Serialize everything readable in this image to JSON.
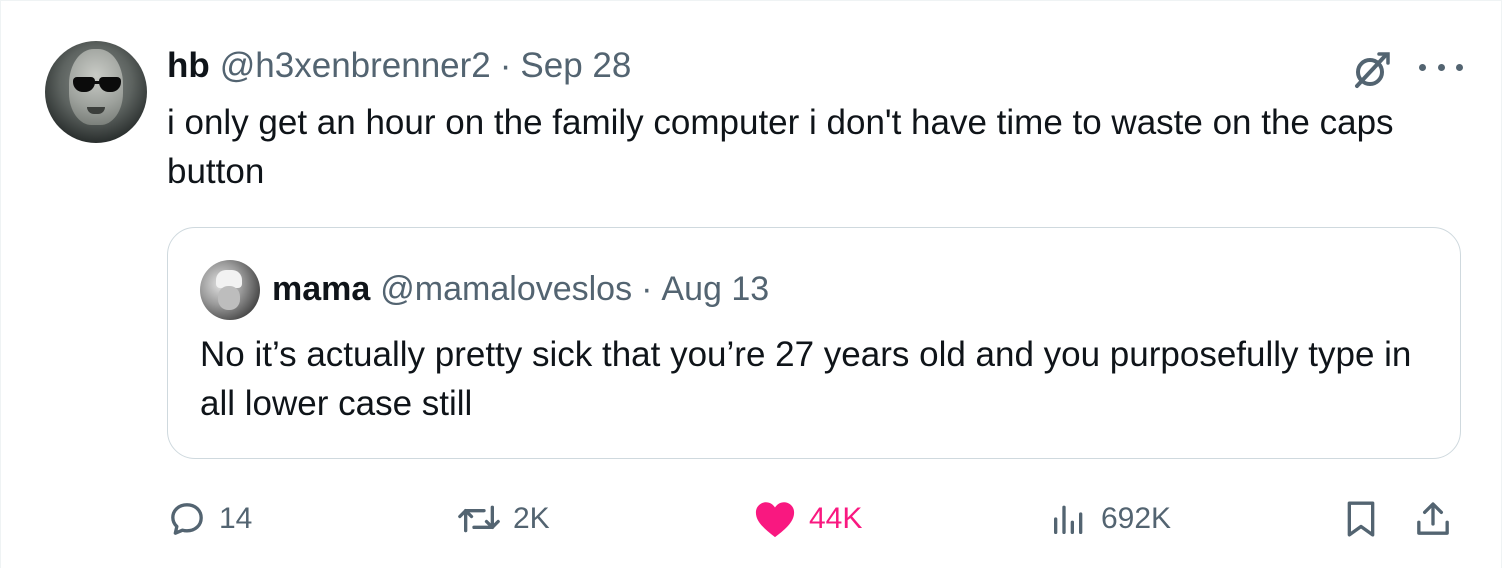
{
  "tweet": {
    "author": {
      "name": "hb",
      "handle": "@h3xenbrenner2",
      "date": "Sep 28"
    },
    "separator": "·",
    "text": "i only get an hour on the family computer i don't have time to waste on the caps button",
    "icons": {
      "avatar": "avatar-image",
      "grok": "grok-icon",
      "more": "more-icon"
    }
  },
  "quoted": {
    "author": {
      "name": "mama",
      "handle": "@mamaloveslos",
      "date": "Aug 13"
    },
    "separator": "·",
    "text": "No it’s actually pretty sick that you’re 27 years old and you purposefully type in all lower case still"
  },
  "actions": {
    "replies": "14",
    "reposts": "2K",
    "likes": "44K",
    "views": "692K",
    "icons": [
      "reply-icon",
      "repost-icon",
      "heart-icon",
      "views-icon",
      "bookmark-icon",
      "share-icon"
    ]
  },
  "colors": {
    "text": "#0f1419",
    "muted": "#536471",
    "like": "#f91880",
    "border": "#cfd9de"
  }
}
